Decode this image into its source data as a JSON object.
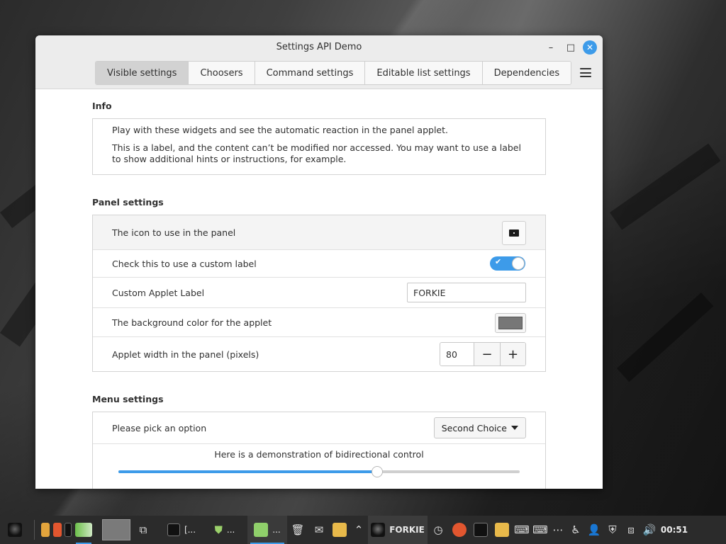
{
  "window": {
    "title": "Settings API Demo",
    "controls": {
      "minimize": "–",
      "maximize": "□",
      "close": "✕"
    }
  },
  "tabs": [
    {
      "label": "Visible settings",
      "active": true
    },
    {
      "label": "Choosers",
      "active": false
    },
    {
      "label": "Command settings",
      "active": false
    },
    {
      "label": "Editable list settings",
      "active": false
    },
    {
      "label": "Dependencies",
      "active": false
    }
  ],
  "info": {
    "heading": "Info",
    "line1": "Play with these widgets and see the automatic reaction in the panel applet.",
    "line2": "This is a label, and the content can’t be modified nor accessed. You may want to use a label to show additional hints or instructions, for example."
  },
  "panel_settings": {
    "heading": "Panel settings",
    "icon_label": "The icon to use in the panel",
    "custom_label_toggle": "Check this to use a custom label",
    "custom_label_enabled": true,
    "custom_applet_label": "Custom Applet Label",
    "custom_applet_value": "FORKIE",
    "bg_color_label": "The background color for the applet",
    "bg_color": "#777777",
    "width_label": "Applet width in the panel (pixels)",
    "width_value": "80",
    "minus": "−",
    "plus": "+"
  },
  "menu_settings": {
    "heading": "Menu settings",
    "pick_label": "Please pick an option",
    "pick_value": "Second Choice",
    "slider_label": "Here is a demonstration of bidirectional control",
    "slider_value": 0.645
  },
  "taskbar": {
    "terminal_label": "[...",
    "shield_label": "...",
    "settings_label": "...",
    "applet_label": "FORKIE",
    "clock": "00:51"
  },
  "colors": {
    "accent": "#3d9be9",
    "tab_active": "#d2d2d2",
    "panel_bg": "#2b2b2b"
  }
}
